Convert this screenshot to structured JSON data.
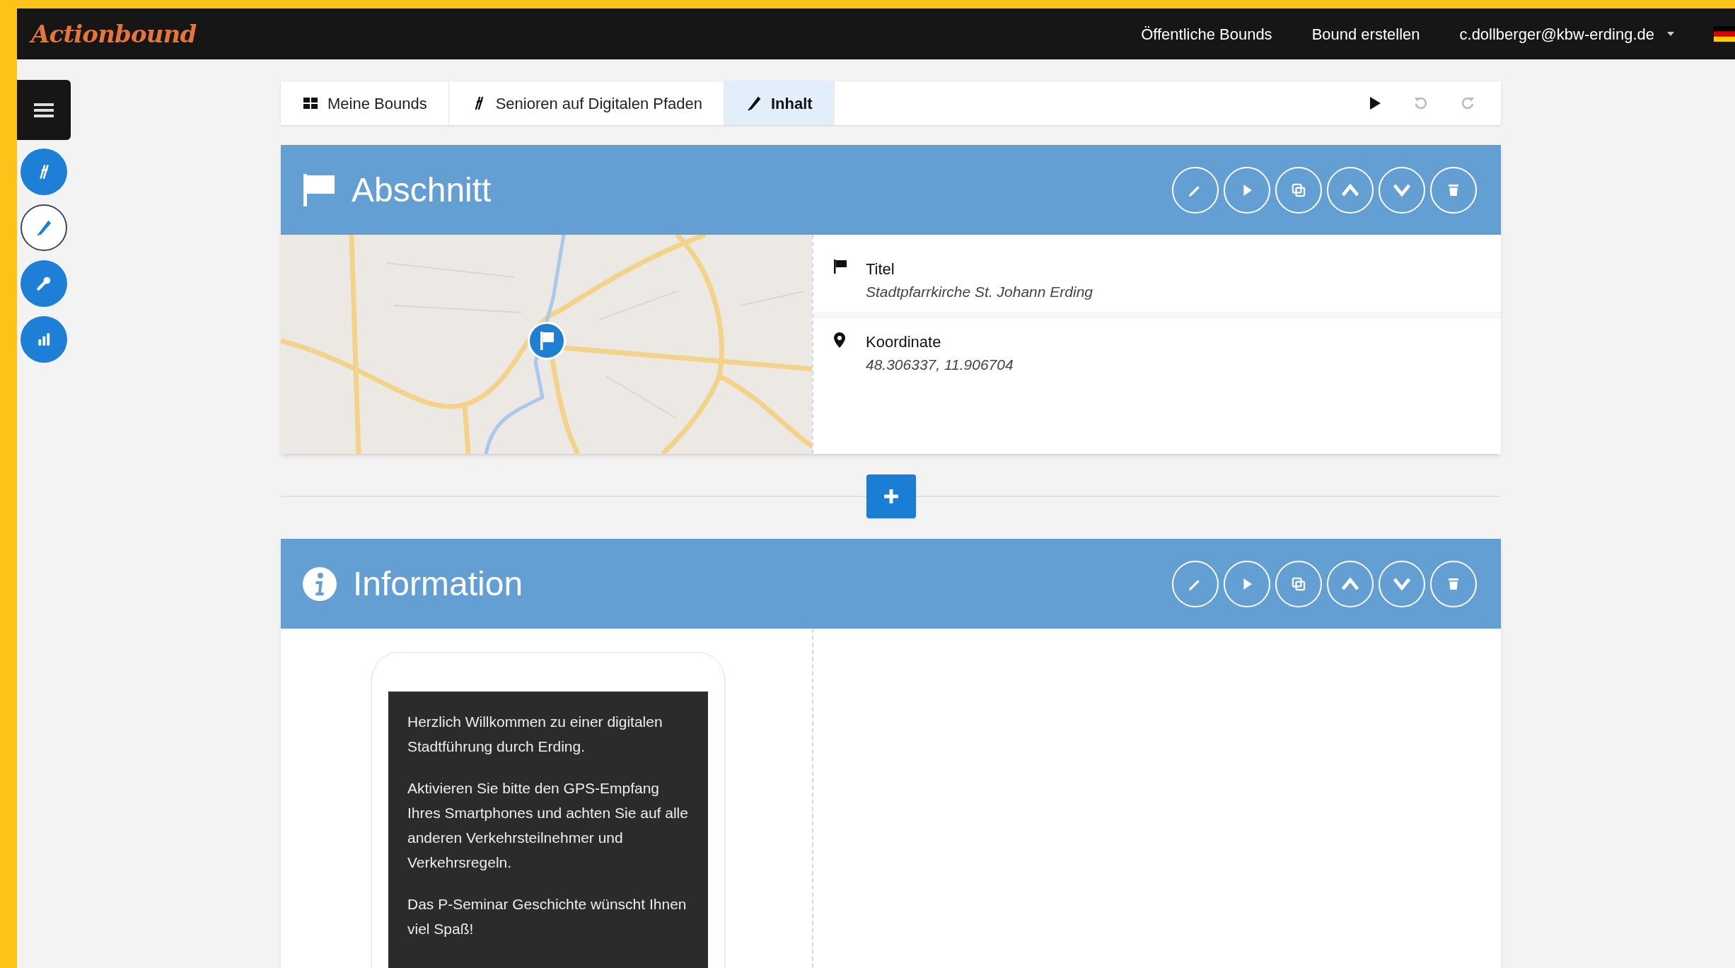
{
  "header": {
    "logo": "Actionbound",
    "nav": [
      "Öffentliche Bounds",
      "Bound erstellen"
    ],
    "user": "c.dollberger@kbw-erding.de"
  },
  "sidebar": {
    "items": [
      {
        "kind": "bound",
        "selected": false
      },
      {
        "kind": "edit",
        "selected": true
      },
      {
        "kind": "tools",
        "selected": false
      },
      {
        "kind": "stats",
        "selected": false
      }
    ]
  },
  "breadcrumb": [
    {
      "kind": "grid",
      "label": "Meine Bounds",
      "selected": false
    },
    {
      "kind": "bound",
      "label": "Senioren auf Digitalen Pfaden",
      "selected": false
    },
    {
      "kind": "edit",
      "label": "Inhalt",
      "selected": true
    }
  ],
  "cards": [
    {
      "kind": "section",
      "title": "Abschnitt",
      "fields": [
        {
          "kind": "flag",
          "label": "Titel",
          "value": "Stadtpfarrkirche St. Johann Erding"
        },
        {
          "kind": "pin",
          "label": "Koordinate",
          "value": "48.306337, 11.906704"
        }
      ]
    },
    {
      "kind": "information",
      "title": "Information",
      "paragraphs": [
        "Herzlich Willkommen zu einer digitalen Stadtführung durch Erding.",
        "Aktivieren Sie bitte den GPS-Empfang Ihres Smartphones und achten Sie auf alle anderen Verkehrsteilnehmer und Verkehrsregeln.",
        "Das P-Seminar Geschichte wünscht Ihnen viel Spaß!"
      ]
    }
  ]
}
